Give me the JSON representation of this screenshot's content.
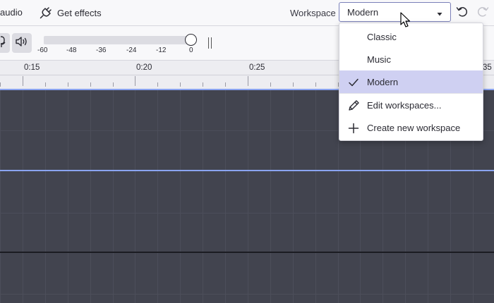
{
  "toolbar": {
    "audio_label": "audio",
    "effects_label": "Get effects",
    "workspace_label": "Workspace",
    "workspace_value": "Modern"
  },
  "meter": {
    "ticks": [
      "-60",
      "-48",
      "-36",
      "-24",
      "-12",
      "0"
    ]
  },
  "ruler": {
    "labels": [
      "0:15",
      "0:20",
      "0:25",
      "35"
    ]
  },
  "workspace_menu": {
    "items": [
      {
        "label": "Classic",
        "icon": "none",
        "selected": false
      },
      {
        "label": "Music",
        "icon": "none",
        "selected": false
      },
      {
        "label": "Modern",
        "icon": "check-icon",
        "selected": true
      },
      {
        "label": "Edit workspaces...",
        "icon": "pencil-icon",
        "selected": false
      },
      {
        "label": "Create new workspace",
        "icon": "plus-icon",
        "selected": false
      }
    ]
  },
  "colors": {
    "track_bg": "#42444f",
    "menu_selected": "#cfd0f2",
    "select_border": "#7a7fb8",
    "clip_line": "#8aa4f0"
  }
}
